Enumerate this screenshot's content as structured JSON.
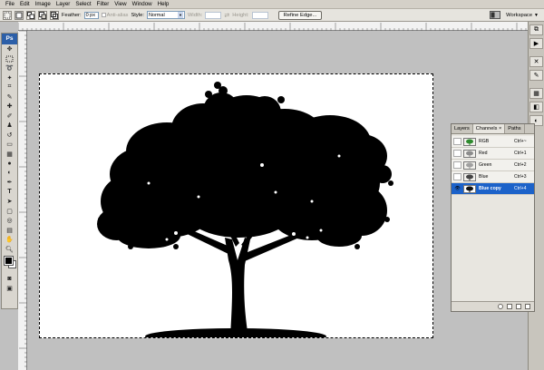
{
  "menu": [
    "File",
    "Edit",
    "Image",
    "Layer",
    "Select",
    "Filter",
    "View",
    "Window",
    "Help"
  ],
  "options": {
    "feather_label": "Feather:",
    "feather_value": "0 px",
    "antialias_label": "Anti-alias",
    "style_label": "Style:",
    "style_value": "Normal",
    "width_label": "Width:",
    "height_label": "Height:",
    "refine_edge": "Refine Edge...",
    "workspace": "Workspace"
  },
  "toolbox": {
    "badge": "Ps"
  },
  "panel": {
    "tabs": [
      "Layers",
      "Channels",
      "Paths"
    ],
    "channels": [
      {
        "name": "RGB",
        "shortcut": "Ctrl+~",
        "thumb": "#2e8b2e",
        "eye": "true"
      },
      {
        "name": "Red",
        "shortcut": "Ctrl+1",
        "thumb": "#8c8c8c",
        "eye": "false"
      },
      {
        "name": "Green",
        "shortcut": "Ctrl+2",
        "thumb": "#a0a0a0",
        "eye": "false"
      },
      {
        "name": "Blue",
        "shortcut": "Ctrl+3",
        "thumb": "#444444",
        "eye": "false"
      },
      {
        "name": "Blue copy",
        "shortcut": "Ctrl+4",
        "thumb": "#111111",
        "eye": "true"
      }
    ]
  },
  "colors": {
    "accent": "#1c62c9",
    "workspace_bg": "#c0c0c0",
    "ps_badge": "#2c5fa8"
  }
}
